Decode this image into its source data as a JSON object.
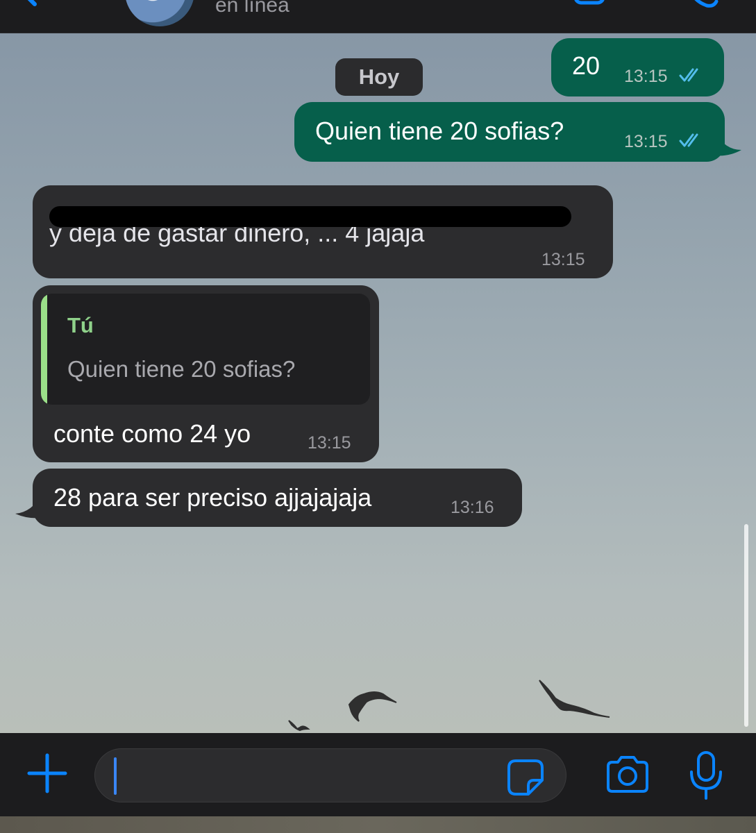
{
  "header": {
    "status": "en línea"
  },
  "date_divider": "Hoy",
  "messages": [
    {
      "direction": "outgoing",
      "text": "20",
      "time": "13:15",
      "read": true
    },
    {
      "direction": "outgoing",
      "text": "Quien tiene 20 sofias?",
      "time": "13:15",
      "read": true
    },
    {
      "direction": "incoming",
      "text": "y deja de gastar dinero, ... 4 jajaja",
      "redacted": true,
      "time": "13:15"
    },
    {
      "direction": "incoming",
      "quote": {
        "author": "Tú",
        "text": "Quien tiene 20 sofias?"
      },
      "text": "conte como 24 yo",
      "time": "13:15"
    },
    {
      "direction": "incoming",
      "text": "28 para ser preciso ajjajajaja",
      "time": "13:16"
    }
  ],
  "composer": {
    "placeholder": ""
  },
  "icons": {
    "back": "chevron-left-icon",
    "video": "video-call-icon",
    "call": "phone-icon",
    "add": "plus-icon",
    "sticker": "sticker-icon",
    "camera": "camera-icon",
    "mic": "microphone-icon",
    "read_receipt": "double-check-icon"
  },
  "colors": {
    "accent": "#0a84ff",
    "outgoing_bubble": "#065f4b",
    "incoming_bubble": "#2c2c2e",
    "read_tick": "#53bdeb",
    "quote_accent": "#9be089"
  }
}
